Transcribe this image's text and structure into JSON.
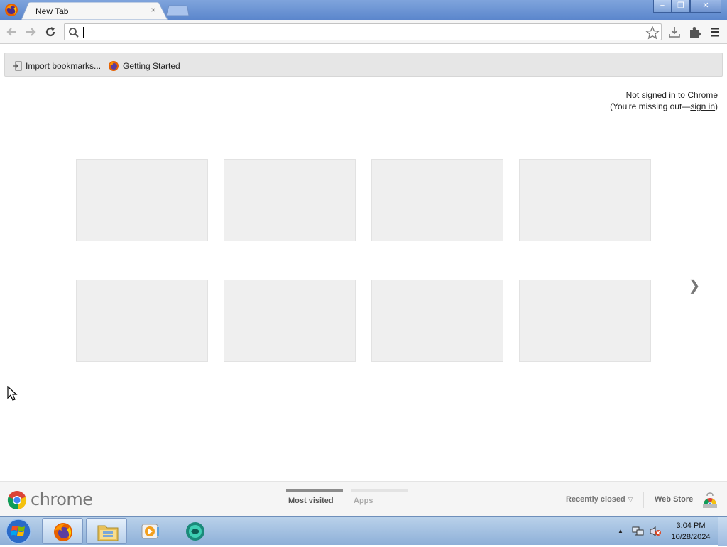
{
  "browser": {
    "tab": {
      "title": "New Tab",
      "close_glyph": "×"
    },
    "window_controls": {
      "minimize": "−",
      "restore": "❐",
      "close": "✕"
    }
  },
  "omnibox": {
    "value": "",
    "placeholder": ""
  },
  "bookmarks_bar": {
    "items": [
      {
        "label": "Import bookmarks...",
        "icon": "import-icon"
      },
      {
        "label": "Getting Started",
        "icon": "firefox-icon"
      }
    ]
  },
  "signin": {
    "line1": "Not signed in to Chrome",
    "line2_prefix": "(You're missing out—",
    "link": "sign in",
    "line2_suffix": ")"
  },
  "most_visited": {
    "tile_count": 8,
    "next_glyph": "❯"
  },
  "footer": {
    "brand": "chrome",
    "tabs": [
      {
        "label": "Most visited",
        "selected": true
      },
      {
        "label": "Apps",
        "selected": false
      }
    ],
    "recently_closed": "Recently closed",
    "recently_closed_arrow": "▽",
    "web_store": "Web Store"
  },
  "taskbar": {
    "apps": [
      {
        "name": "firefox",
        "active": true
      },
      {
        "name": "file-explorer",
        "active": true
      },
      {
        "name": "media-player",
        "active": false
      },
      {
        "name": "other-app",
        "active": false
      }
    ],
    "tray": {
      "overflow_glyph": "▲"
    },
    "clock": {
      "time": "3:04 PM",
      "date": "10/28/2024"
    }
  },
  "colors": {
    "titlebar": "#5b86cc",
    "tile_bg": "#efefef",
    "selected_tab_bar": "#8c8c8c",
    "unselected_tab_bar": "#e3e3e3"
  }
}
